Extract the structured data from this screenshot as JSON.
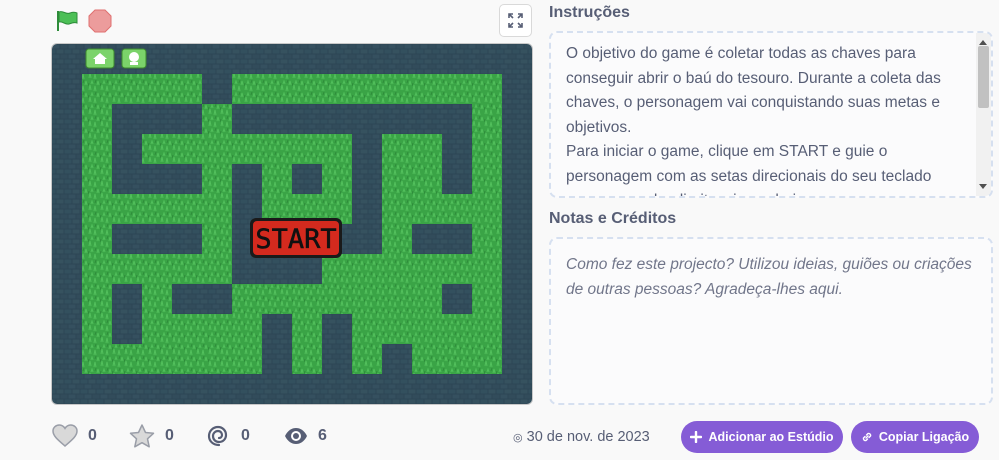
{
  "controls": {
    "green_flag_icon": "green-flag-icon",
    "stop_icon": "stop-icon",
    "fullscreen_icon": "fullscreen-icon"
  },
  "stage": {
    "start_label": "START",
    "home_icon": "home-icon",
    "help_icon": "help-icon"
  },
  "instructions": {
    "title": "Instruções",
    "text": "O objetivo do game é coletar todas as chaves para conseguir abrir o baú do tesouro. Durante a coleta das chaves, o personagem vai conquistando suas metas e objetivos.\nPara iniciar o game, clique em START e guie o personagem com as setas direcionais do seu teclado para esquerda, direita, cima e baixo. o personagem"
  },
  "notes": {
    "title": "Notas e Créditos",
    "placeholder": "Como fez este projecto? Utilizou ideias, guiões ou criações de outras pessoas? Agradeça-lhes aqui."
  },
  "stats": {
    "loves": "0",
    "favorites": "0",
    "remixes": "0",
    "views": "6"
  },
  "date": "30 de nov. de 2023",
  "buttons": {
    "add_to_studio": "Adicionar ao Estúdio",
    "copy_link": "Copiar Ligação"
  },
  "colors": {
    "accent": "#855cd6",
    "grass": "#3ea84a",
    "wall": "#2f4a5a",
    "start_button": "#d42a1e"
  }
}
